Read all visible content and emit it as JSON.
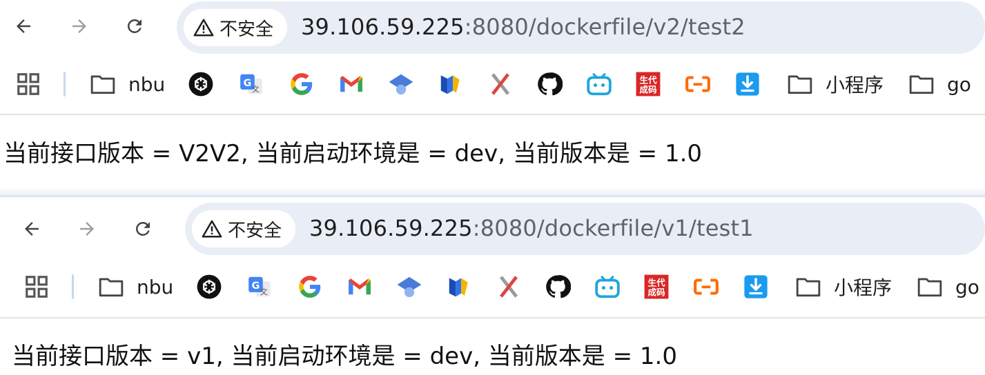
{
  "windows": [
    {
      "security_label": "不安全",
      "url_host": "39.106.59.225",
      "url_rest": ":8080/dockerfile/v2/test2",
      "page_text": "当前接口版本 = V2V2, 当前启动环境是 = dev, 当前版本是 = 1.0"
    },
    {
      "security_label": "不安全",
      "url_host": "39.106.59.225",
      "url_rest": ":8080/dockerfile/v1/test1",
      "page_text": "当前接口版本 = v1, 当前启动环境是 = dev, 当前版本是 = 1.0"
    }
  ],
  "bookmarks": {
    "folder_nbu": "nbu",
    "folder_miniprogram": "小程序",
    "folder_go": "go"
  },
  "icons": {
    "back": "arrow-left-icon",
    "forward": "arrow-right-icon",
    "reload": "reload-icon",
    "warning": "warning-triangle-icon",
    "apps": "apps-grid-icon",
    "folder": "folder-icon",
    "chatgpt": "chatgpt-icon",
    "translate": "google-translate-icon",
    "google": "google-icon",
    "gmail": "gmail-icon",
    "gemini": "hat-icon",
    "pen": "pen-icon",
    "cross": "x-icon",
    "github": "github-icon",
    "bilibili": "bilibili-icon",
    "codegen": "code-generator-icon",
    "aliyun": "aliyun-icon",
    "download": "download-icon"
  },
  "colors": {
    "omnibox_bg": "#e9eef6",
    "url_host": "#1f1f1f",
    "url_rest": "#5f6368",
    "disabled_forward": "#9aa0a6"
  }
}
